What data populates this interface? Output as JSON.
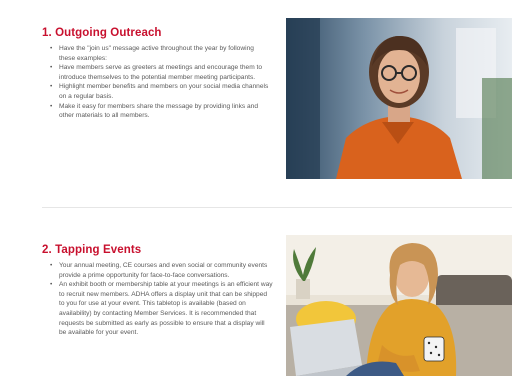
{
  "sections": [
    {
      "title": "1. Outgoing Outreach",
      "bullets": [
        "Have the \"join us\" message active throughout the year by following these examples:",
        "Have members serve as greeters at meetings and encourage them to introduce themselves to the potential member meeting participants.",
        "Highlight member benefits and members on your social media channels on a regular basis.",
        "Make it easy for members share the message by providing links and other materials to all members."
      ],
      "photo_icon": "photo-woman-with-glasses"
    },
    {
      "title": "2. Tapping Events",
      "bullets": [
        "Your annual meeting, CE courses and even social or community events provide a prime opportunity for face-to-face conversations.",
        "An exhibit booth or membership table at your meetings is an efficient way to recruit new members. ADHA offers a display unit that can be shipped to you for use at your event. This tabletop is available (based on availability) by contacting Member Services. It is recommended that requests be submitted as early as possible to ensure that a display will be available for your event."
      ],
      "photo_icon": "photo-woman-with-laptop"
    }
  ],
  "colors": {
    "heading": "#c8102e",
    "body_text": "#5a5a5a",
    "divider": "#e6e6e6"
  }
}
